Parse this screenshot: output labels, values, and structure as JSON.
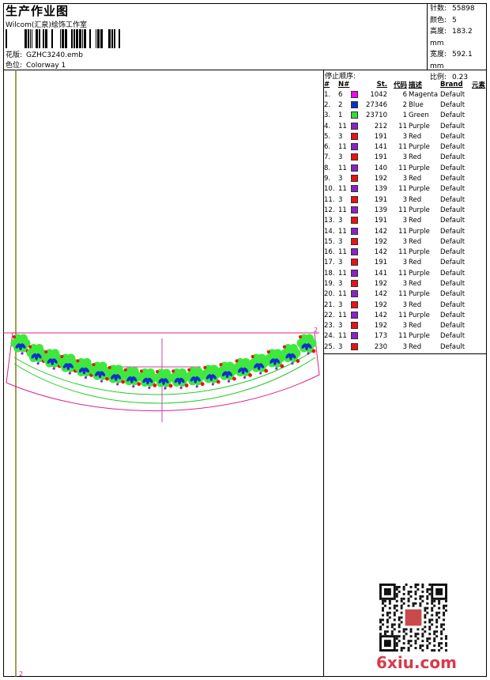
{
  "header": {
    "title": "生产作业图",
    "subtitle": "Wilcom(汇泉)绘饰工作室",
    "design_label": "花版:",
    "design_value": "GZHC3240.emb",
    "colorway_label": "色位:",
    "colorway_value": "Colorway 1"
  },
  "stats": {
    "stitches_label": "针数:",
    "stitches": "55898",
    "colors_label": "颜色:",
    "colors": "5",
    "height_label": "高度:",
    "height": "183.2 mm",
    "width_label": "宽度:",
    "width": "592.1 mm",
    "scale_label": "比例:",
    "scale": "0.23"
  },
  "sequence": {
    "title": "停止顺序:",
    "headers": [
      "#",
      "N#",
      "St.",
      "代码",
      "描述",
      "Brand",
      "元素"
    ],
    "rows": [
      [
        "1.",
        "6",
        "#ff00ff",
        "1042",
        "6",
        "Magenta",
        "Default"
      ],
      [
        "2.",
        "2",
        "#0033cc",
        "27346",
        "2",
        "Blue",
        "Default"
      ],
      [
        "3.",
        "1",
        "#33dd33",
        "23710",
        "1",
        "Green",
        "Default"
      ],
      [
        "4.",
        "11",
        "#8822cc",
        "212",
        "11",
        "Purple",
        "Default"
      ],
      [
        "5.",
        "3",
        "#ee1111",
        "191",
        "3",
        "Red",
        "Default"
      ],
      [
        "6.",
        "11",
        "#8822cc",
        "141",
        "11",
        "Purple",
        "Default"
      ],
      [
        "7.",
        "3",
        "#ee1111",
        "191",
        "3",
        "Red",
        "Default"
      ],
      [
        "8.",
        "11",
        "#8822cc",
        "140",
        "11",
        "Purple",
        "Default"
      ],
      [
        "9.",
        "3",
        "#ee1111",
        "192",
        "3",
        "Red",
        "Default"
      ],
      [
        "10.",
        "11",
        "#8822cc",
        "139",
        "11",
        "Purple",
        "Default"
      ],
      [
        "11.",
        "3",
        "#ee1111",
        "191",
        "3",
        "Red",
        "Default"
      ],
      [
        "12.",
        "11",
        "#8822cc",
        "139",
        "11",
        "Purple",
        "Default"
      ],
      [
        "13.",
        "3",
        "#ee1111",
        "191",
        "3",
        "Red",
        "Default"
      ],
      [
        "14.",
        "11",
        "#8822cc",
        "142",
        "11",
        "Purple",
        "Default"
      ],
      [
        "15.",
        "3",
        "#ee1111",
        "192",
        "3",
        "Red",
        "Default"
      ],
      [
        "16.",
        "11",
        "#8822cc",
        "142",
        "11",
        "Purple",
        "Default"
      ],
      [
        "17.",
        "3",
        "#ee1111",
        "191",
        "3",
        "Red",
        "Default"
      ],
      [
        "18.",
        "11",
        "#8822cc",
        "141",
        "11",
        "Purple",
        "Default"
      ],
      [
        "19.",
        "3",
        "#ee1111",
        "192",
        "3",
        "Red",
        "Default"
      ],
      [
        "20.",
        "11",
        "#8822cc",
        "142",
        "11",
        "Purple",
        "Default"
      ],
      [
        "21.",
        "3",
        "#ee1111",
        "192",
        "3",
        "Red",
        "Default"
      ],
      [
        "22.",
        "11",
        "#8822cc",
        "142",
        "11",
        "Purple",
        "Default"
      ],
      [
        "23.",
        "3",
        "#ee1111",
        "192",
        "3",
        "Red",
        "Default"
      ],
      [
        "24.",
        "11",
        "#8822cc",
        "173",
        "11",
        "Purple",
        "Default"
      ],
      [
        "25.",
        "3",
        "#ee1111",
        "230",
        "3",
        "Red",
        "Default"
      ]
    ]
  },
  "design_marks": {
    "start": "2",
    "end": "2"
  },
  "watermark": "6xiu.com"
}
